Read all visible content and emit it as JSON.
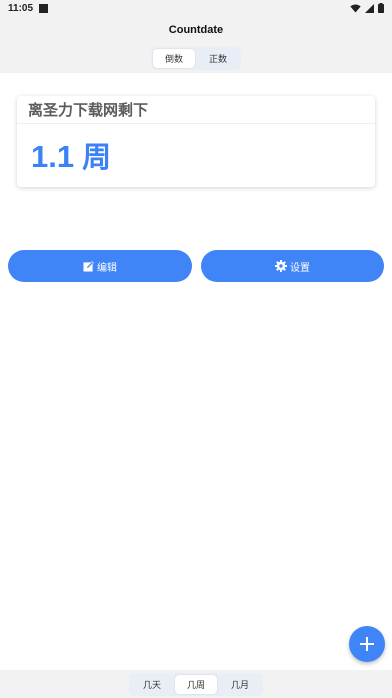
{
  "status": {
    "time": "11:05"
  },
  "app": {
    "title": "Countdate"
  },
  "mode_tabs": [
    {
      "label": "倒数",
      "selected": true
    },
    {
      "label": "正数",
      "selected": false
    }
  ],
  "card": {
    "title": "离圣力下载网剩下",
    "value": "1.1",
    "unit": "周"
  },
  "actions": {
    "edit_label": "编辑",
    "settings_label": "设置"
  },
  "unit_tabs": [
    {
      "label": "几天",
      "selected": false
    },
    {
      "label": "几周",
      "selected": true
    },
    {
      "label": "几月",
      "selected": false
    }
  ],
  "colors": {
    "accent": "#3f85f7",
    "value_text": "#3b82f6"
  },
  "icons": {
    "fab": "plus-icon",
    "edit": "edit-icon",
    "settings": "gear-icon"
  }
}
